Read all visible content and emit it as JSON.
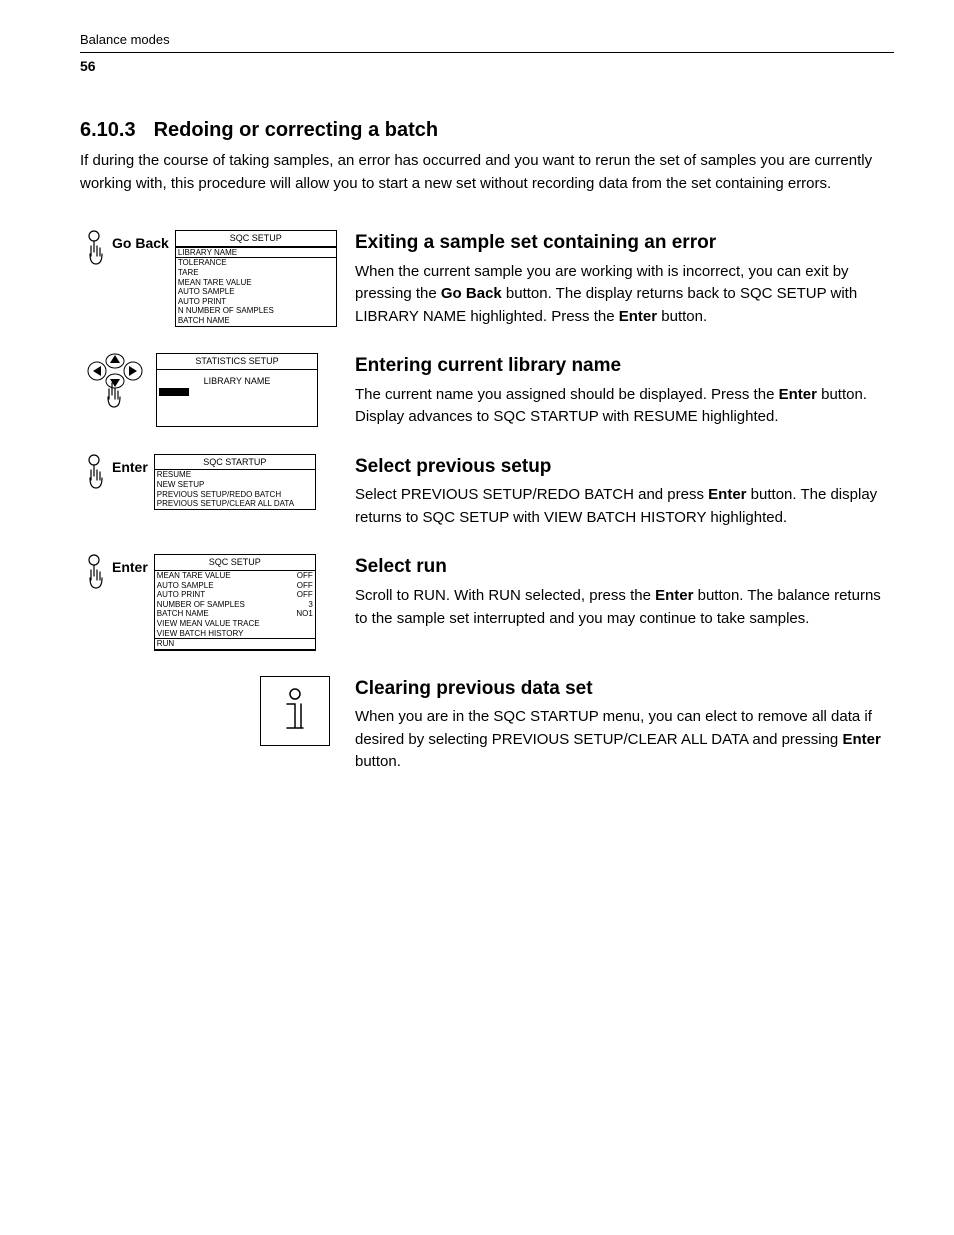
{
  "header": {
    "chapter": "Balance modes",
    "page": "56"
  },
  "section": {
    "number": "6.10.3",
    "title": "Redoing or correcting a batch",
    "intro": "If during the course of taking samples, an error has occurred and you want to rerun the set of samples you are currently working with, this procedure will allow you to start a new set without recording data from the set containing errors."
  },
  "steps": [
    {
      "hand_label": "Go Back",
      "screen": {
        "title": "SQC SETUP",
        "lines": [
          "LIBRARY NAME",
          "TOLERANCE",
          "TARE",
          "MEAN TARE VALUE",
          "AUTO SAMPLE",
          "AUTO PRINT",
          "N NUMBER OF SAMPLES",
          "BATCH NAME"
        ],
        "highlight_index": 0
      },
      "heading": "Exiting a sample set containing an error",
      "body_html": "When the current sample you are working with is incorrect, you can exit by pressing the <b>Go Back</b> button. The display returns back to SQC SETUP with LIBRARY NAME highlighted. Press the <b>Enter</b> button."
    },
    {
      "hand_label": "",
      "nav_icon": true,
      "screen": {
        "title": "STATISTICS SETUP",
        "custom": "libname"
      },
      "heading": "Entering current library name",
      "body_html": "The current name you assigned should be displayed. Press the <b>Enter</b> button. Display advances to SQC STARTUP with RESUME highlighted."
    },
    {
      "hand_label": "Enter",
      "screen": {
        "title": "SQC STARTUP",
        "lines": [
          "RESUME",
          "NEW SETUP",
          "PREVIOUS SETUP/REDO BATCH",
          "PREVIOUS SETUP/CLEAR ALL DATA"
        ],
        "highlight_index": -1
      },
      "heading": "Select previous setup",
      "body_html": "Select PREVIOUS SETUP/REDO BATCH and press <b>Enter</b> button. The display returns to SQC SETUP with VIEW BATCH HISTORY highlighted."
    },
    {
      "hand_label": "Enter",
      "screen": {
        "title": "SQC SETUP",
        "pairs": [
          [
            "MEAN TARE VALUE",
            "OFF"
          ],
          [
            "AUTO SAMPLE",
            "OFF"
          ],
          [
            "AUTO PRINT",
            "OFF"
          ],
          [
            "NUMBER OF SAMPLES",
            "3"
          ],
          [
            "BATCH NAME",
            "NO1"
          ],
          [
            "VIEW MEAN VALUE TRACE",
            ""
          ],
          [
            "VIEW BATCH HISTORY",
            ""
          ],
          [
            "RUN",
            ""
          ]
        ],
        "highlight_index": 7
      },
      "heading": "Select run",
      "body_html": "Scroll to RUN. With RUN selected, press the <b>Enter</b> button. The balance returns to the sample set interrupted and you may continue to take samples."
    },
    {
      "info_icon": true,
      "heading": "Clearing previous data set",
      "body_html": "When you are in the SQC STARTUP menu, you can elect to remove all data if desired by selecting PREVIOUS SETUP/CLEAR ALL DATA and pressing <b>Enter</b> button."
    }
  ]
}
